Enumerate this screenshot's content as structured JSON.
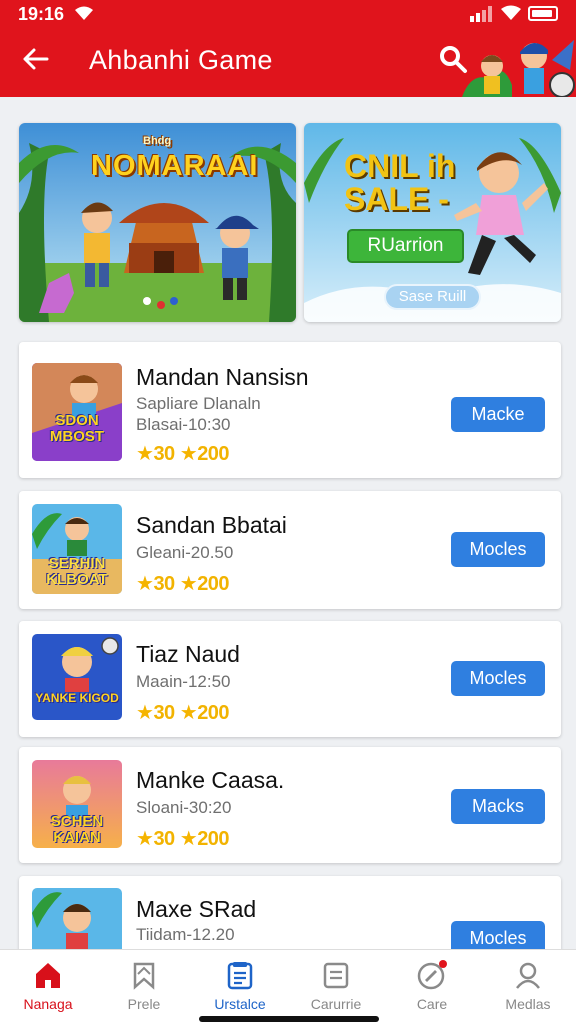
{
  "status_bar": {
    "time": "19:16"
  },
  "header": {
    "title": "Ahbanhi Game"
  },
  "banners": [
    {
      "small": "Bhdg",
      "heading": "NOMARAAI"
    },
    {
      "heading_line1": "CNIL ih",
      "heading_line2": "SALE -",
      "button": "RUarrion",
      "pill": "Sase Ruill"
    }
  ],
  "games": [
    {
      "name": "Mandan Nansisn",
      "sub1": "Sapliare Dlanaln",
      "sub2": "Blasai-10:30",
      "rating": "30",
      "reviews": "200",
      "button": "Macke",
      "thumb_text": "SDON MBOST"
    },
    {
      "name": "Sandan Bbatai",
      "sub1": "Gleani-20.50",
      "rating": "30",
      "reviews": "200",
      "button": "Mocles",
      "thumb_text": "SERHIN KLBOAT"
    },
    {
      "name": "Tiaz Naud",
      "sub1": "Maain-12:50",
      "rating": "30",
      "reviews": "200",
      "button": "Mocles",
      "thumb_text": "YANKE KIGOD"
    },
    {
      "name": "Manke Caasa.",
      "sub1": "Sloani-30:20",
      "rating": "30",
      "reviews": "200",
      "button": "Macks",
      "thumb_text": "SCHEN KAIAN"
    },
    {
      "name": "Maxe SRad",
      "sub1": "Tiidam-12.20",
      "button": "Mocles"
    }
  ],
  "nav": [
    {
      "label": "Nanaga",
      "icon": "home-icon"
    },
    {
      "label": "Prele",
      "icon": "bookmark-icon"
    },
    {
      "label": "Urstalce",
      "icon": "document-icon"
    },
    {
      "label": "Carurrie",
      "icon": "list-icon"
    },
    {
      "label": "Care",
      "icon": "compass-icon"
    },
    {
      "label": "Medlas",
      "icon": "profile-icon"
    }
  ],
  "colors": {
    "header": "#e0141c",
    "button": "#2f7fe0",
    "rating": "#f2b300",
    "nav_active": "#d8101a",
    "nav_selected": "#1e64c8"
  }
}
